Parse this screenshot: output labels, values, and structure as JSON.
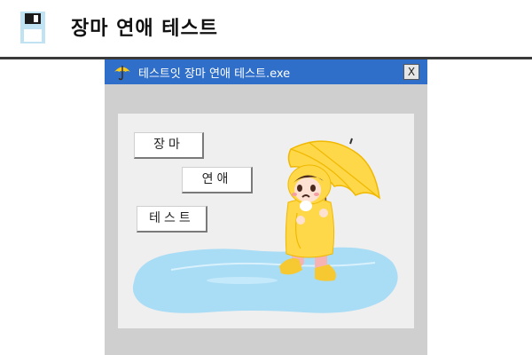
{
  "page": {
    "title": "장마 연애 테스트"
  },
  "window": {
    "title": "테스트잇 장마 연애 테스트.exe",
    "close_label": "X"
  },
  "buttons": [
    "장마",
    "연애",
    "테스트"
  ],
  "icons": {
    "header": "floppy-disk-icon",
    "titlebar": "umbrella-icon",
    "illustration": "child-in-raincoat-with-umbrella"
  },
  "colors": {
    "titlebar": "#2f6ec9",
    "window_bg": "#cfcfcf",
    "panel_bg": "#efefef",
    "raincoat": "#ffd84a",
    "puddle": "#a9dcf5"
  }
}
